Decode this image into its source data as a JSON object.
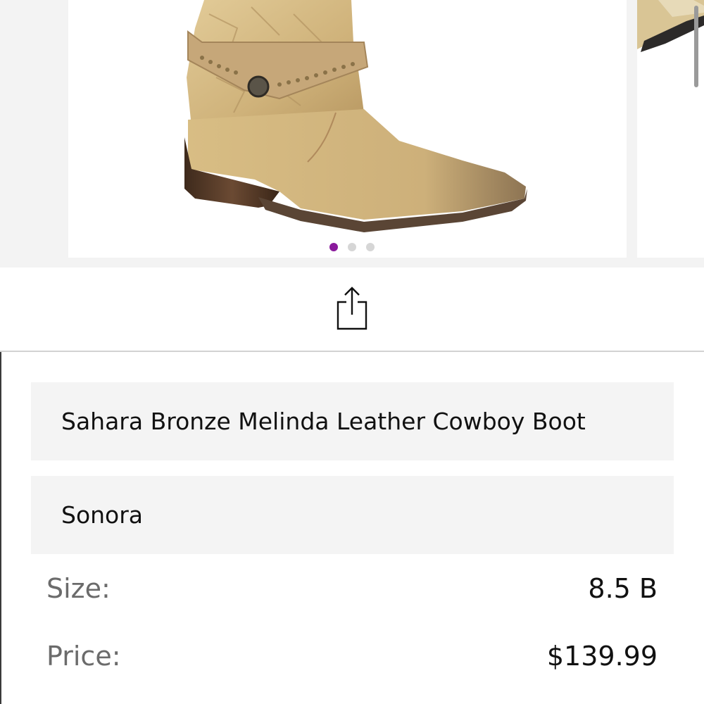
{
  "gallery": {
    "slides": [
      {
        "image": "sahara-bronze-melinda-boot-photo"
      },
      {
        "image": "next-product-photo"
      }
    ],
    "page_count": 3,
    "active_index": 0,
    "active_color": "#8a1a9c"
  },
  "share": {
    "icon": "share-icon"
  },
  "product": {
    "title": "Sahara Bronze Melinda Leather Cowboy Boot",
    "brand": "Sonora",
    "size_label": "Size:",
    "size_value": "8.5 B",
    "price_label": "Price:",
    "price_value": "$139.99"
  }
}
